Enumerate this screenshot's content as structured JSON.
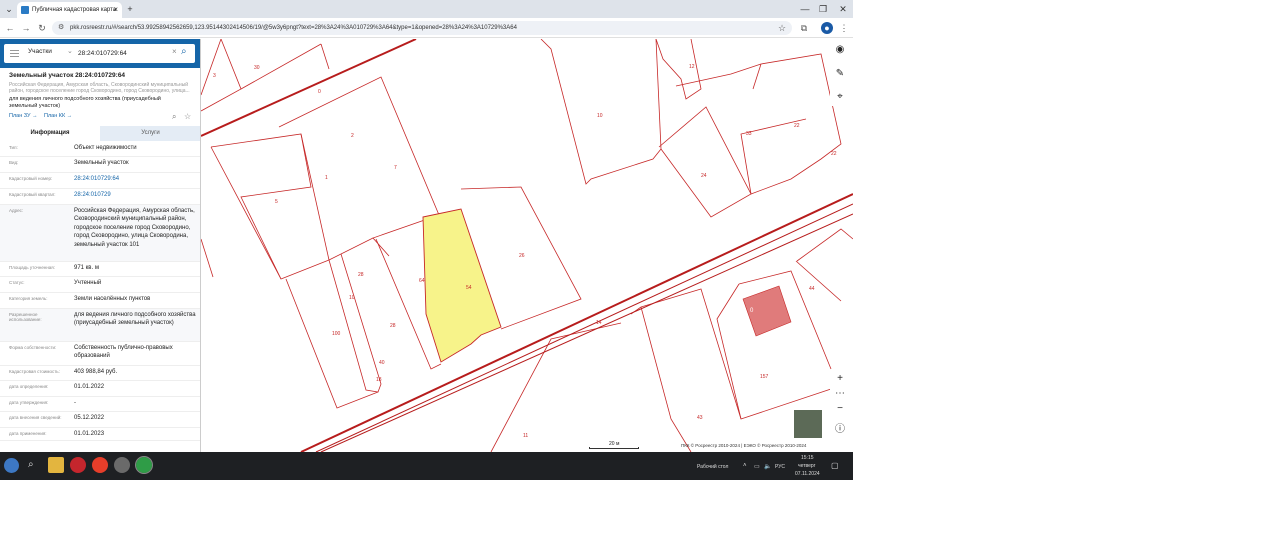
{
  "browser": {
    "tab_title": "Публичная кадастровая карта",
    "tab_close": "×",
    "new_tab": "+",
    "url": "pkk.rosreestr.ru/#/search/53.99258942562659,123.95144302414506/19/@5w3y6pngt?text=28%3A24%3A010729%3A64&type=1&opened=28%3A24%3A10729%3A64",
    "win_min": "—",
    "win_max": "❐",
    "win_close": "✕"
  },
  "panel": {
    "category": "Участки",
    "search_value": "28:24:010729:64",
    "title": "Земельный участок 28:24:010729:64",
    "address_small": "Российская Федерация, Амурская область, Сковородинский муниципальный район, городское поселение город Сковородино, город Сковородино, улица...",
    "purpose": "для ведения личного подсобного хозяйства (приусадебный земельный участок)",
    "plan_zu": "План ЗУ →",
    "plan_kk": "План КК →",
    "tab_info": "Информация",
    "tab_services": "Услуги",
    "rows": [
      {
        "k": "Тип:",
        "v": "Объект недвижимости"
      },
      {
        "k": "Вид:",
        "v": "Земельный участок"
      },
      {
        "k": "Кадастровый номер:",
        "v": "28:24:010729:64"
      },
      {
        "k": "Кадастровый квартал:",
        "v": "28:24:010729"
      },
      {
        "k": "Адрес:",
        "v": "Российская Федерация, Амурская область, Сковородинский муниципальный район, городское поселение город Сковородино, город Сковородино, улица Сковородина, земельный участок 101"
      },
      {
        "k": "Площадь уточненная:",
        "v": "971 кв. м"
      },
      {
        "k": "Статус:",
        "v": "Учтенный"
      },
      {
        "k": "Категория земель:",
        "v": "Земли населённых пунктов"
      },
      {
        "k": "Разрешенное использование:",
        "v": "для ведения личного подсобного хозяйства (приусадебный земельный участок)"
      },
      {
        "k": "Форма собственности:",
        "v": "Собственность публично-правовых образований"
      },
      {
        "k": "Кадастровая стоимость:",
        "v": "403 988,84 руб."
      },
      {
        "k": "дата определения:",
        "v": "01.01.2022"
      },
      {
        "k": "дата утверждения:",
        "v": "-"
      },
      {
        "k": "дата внесения сведений:",
        "v": "05.12.2022"
      },
      {
        "k": "дата применения:",
        "v": "01.01.2023"
      }
    ]
  },
  "map": {
    "labels": [
      "3",
      "30",
      "12",
      "10",
      "0",
      "2",
      "1",
      "7",
      "5",
      "33",
      "22",
      "22",
      "24",
      "26",
      "64",
      "54",
      "28",
      "10",
      "28",
      "100",
      "40",
      "44",
      "0",
      "14",
      "157",
      "43",
      "11",
      "18"
    ],
    "scale": "20 м",
    "copyright": "ПКК © Росреестр 2010-2024 | ЕЭКО © Росреестр 2010-2024",
    "zoom_in": "+",
    "zoom_out": "−",
    "more": "⋯",
    "colors": {
      "selected_fill": "#f7f38a",
      "building_fill": "#e07b7b",
      "boundary": "#c62828"
    }
  },
  "taskbar": {
    "desktop_label": "Рабочий стол",
    "lang": "РУС",
    "time": "15:15",
    "day": "четверг",
    "date": "07.11.2024",
    "icons": [
      "windows-start-icon",
      "search-icon",
      "file-explorer-icon",
      "yandex-browser-icon",
      "yandex-icon",
      "app-icon",
      "chrome-icon"
    ]
  }
}
